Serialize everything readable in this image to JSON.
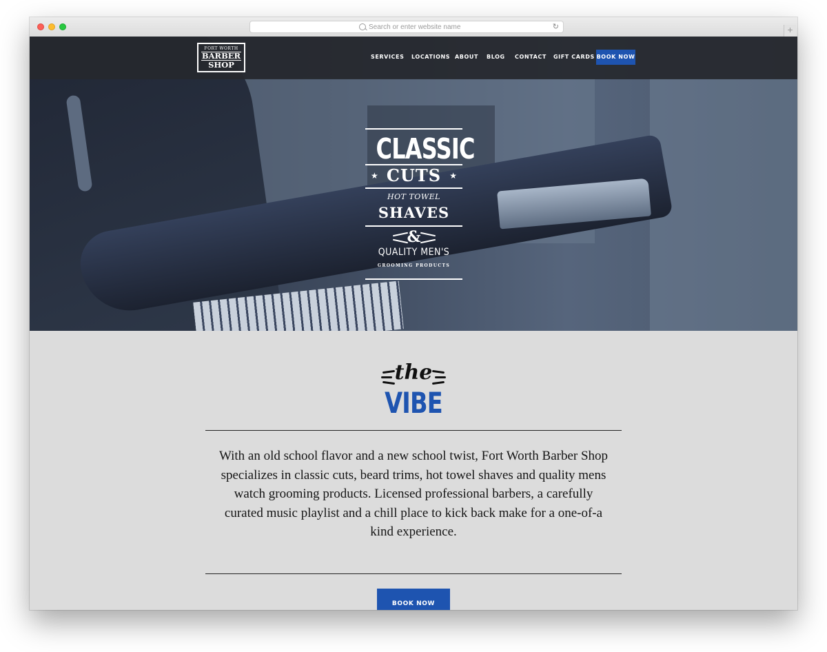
{
  "browser": {
    "url_placeholder": "Search or enter website name",
    "new_tab_label": "+"
  },
  "header": {
    "logo": {
      "line1": "FORT WORTH",
      "line2": "BARBER",
      "line3": "SHOP"
    },
    "nav": [
      {
        "label": "SERVICES"
      },
      {
        "label": "LOCATIONS"
      },
      {
        "label": "ABOUT"
      },
      {
        "label": "BLOG"
      },
      {
        "label": "CONTACT"
      },
      {
        "label": "GIFT CARDS"
      }
    ],
    "book_now": "BOOK NOW"
  },
  "hero": {
    "classic": "CLASSIC",
    "cuts": "CUTS",
    "hot_towel": "HOT TOWEL",
    "shaves": "SHAVES",
    "ampersand": "&",
    "quality": "QUALITY MEN'S",
    "grooming": "GROOMING PRODUCTS",
    "star": "★"
  },
  "vibe": {
    "the": "the",
    "title": "VIBE",
    "body": "With an old school flavor and a new school twist, Fort Worth Barber Shop specializes in classic cuts, beard trims, hot towel shaves and quality mens watch grooming products. Licensed professional barbers, a carefully curated music playlist and a chill place to kick back make for a one-of-a kind experience.",
    "cta": "BOOK NOW"
  },
  "colors": {
    "accent": "#1e54b0",
    "nav_bg": "#26282e",
    "section_bg": "#dcdcdc"
  },
  "icons": [
    "search-icon",
    "reload-icon",
    "star-icon"
  ]
}
